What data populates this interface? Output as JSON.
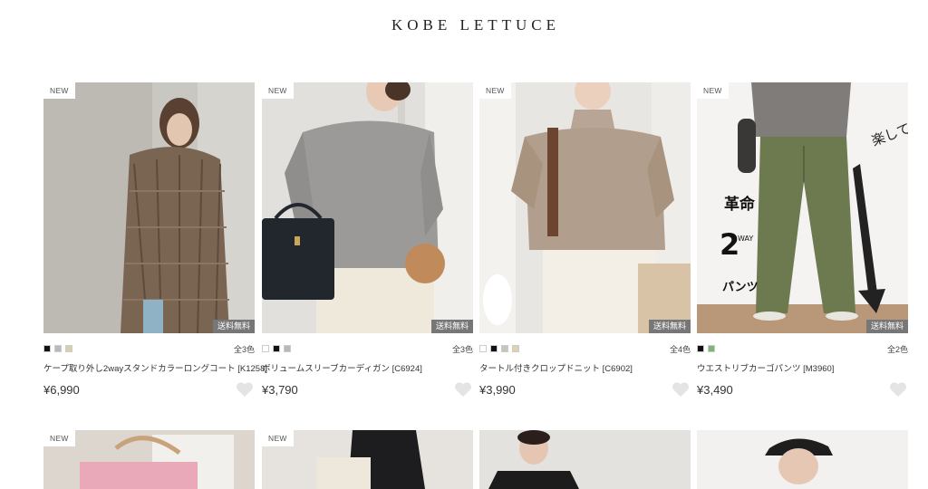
{
  "header": {
    "logo": "KOBE LETTUCE"
  },
  "products": [
    {
      "new_badge": "NEW",
      "shipping_badge": "送料無料",
      "swatches": [
        "#111111",
        "#b9b9b9",
        "#d8cfae"
      ],
      "color_count": "全3色",
      "name": "ケープ取り外し2wayスタンドカラーロングコート [K1258]",
      "price": "¥6,990",
      "image_alt": "woman in brown checked long coat"
    },
    {
      "new_badge": "NEW",
      "shipping_badge": "送料無料",
      "swatches": [
        "#ffffff",
        "#111111",
        "#b9b9b9"
      ],
      "color_count": "全3色",
      "name": "ボリュームスリーブカーディガン [C6924]",
      "price": "¥3,790",
      "image_alt": "woman in grey cardigan with black bag"
    },
    {
      "new_badge": "NEW",
      "shipping_badge": "送料無料",
      "swatches": [
        "#ffffff",
        "#111111",
        "#c9c3bb",
        "#e0d2b0"
      ],
      "color_count": "全4色",
      "name": "タートル付きクロップドニット [C6902]",
      "price": "¥3,990",
      "image_alt": "woman in beige turtleneck knit"
    },
    {
      "new_badge": "NEW",
      "shipping_badge": "送料無料",
      "swatches": [
        "#111111",
        "#7fb37c"
      ],
      "color_count": "全2色",
      "name": "ウエストリブカーゴパンツ [M3960]",
      "price": "¥3,490",
      "image_alt": "woman in olive cargo pants",
      "overlay_text_1": "楽して脚長!",
      "overlay_text_2": "革命",
      "overlay_text_3": "2",
      "overlay_text_4": "WAY",
      "overlay_text_5": "パンツ"
    }
  ],
  "row2": [
    {
      "new_badge": "NEW"
    },
    {
      "new_badge": "NEW"
    },
    {
      "new_badge": ""
    },
    {
      "new_badge": ""
    }
  ]
}
